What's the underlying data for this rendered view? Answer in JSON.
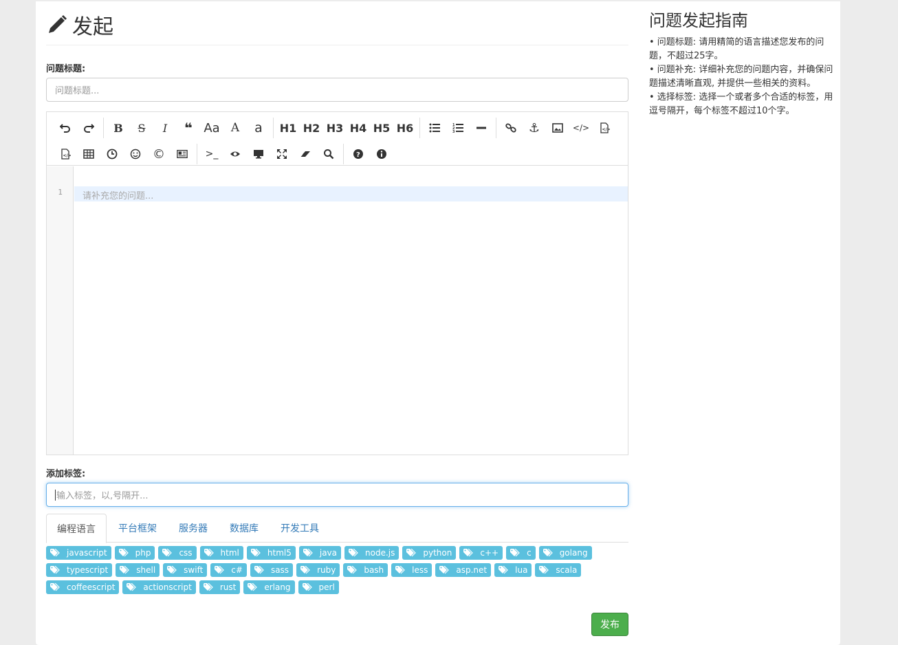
{
  "header": {
    "title": "发起",
    "icon": "pencil-icon"
  },
  "form": {
    "title_label": "问题标题:",
    "title_placeholder": "问题标题...",
    "content_placeholder": "请补充您的问题...",
    "line_number": "1",
    "tags_label": "添加标签:",
    "tags_placeholder": "输入标签，以,号隔开..."
  },
  "toolbar": {
    "row1": [
      "undo-icon",
      "redo-icon",
      "bold-icon",
      "strikethrough-icon",
      "italic-icon",
      "quote-icon",
      "uppercase-icon",
      "case-first-icon",
      "lowercase-icon",
      "h1",
      "h2",
      "h3",
      "h4",
      "h5",
      "h6",
      "unordered-list-icon",
      "ordered-list-icon",
      "horizontal-rule-icon",
      "link-icon",
      "anchor-icon",
      "image-icon",
      "code-icon",
      "code-block-icon"
    ],
    "headings": [
      "H1",
      "H2",
      "H3",
      "H4",
      "H5",
      "H6"
    ],
    "uppercase_text": "Aa",
    "case_first_text": "A",
    "lowercase_text": "a"
  },
  "tabs": [
    "编程语言",
    "平台框架",
    "服务器",
    "数据库",
    "开发工具"
  ],
  "tags": [
    "javascript",
    "php",
    "css",
    "html",
    "html5",
    "java",
    "node.js",
    "python",
    "c++",
    "c",
    "golang",
    "typescript",
    "shell",
    "swift",
    "c#",
    "sass",
    "ruby",
    "bash",
    "less",
    "asp.net",
    "lua",
    "scala",
    "coffeescript",
    "actionscript",
    "rust",
    "erlang",
    "perl"
  ],
  "submit_label": "发布",
  "guide": {
    "title": "问题发起指南",
    "items": [
      "• 问题标题: 请用精简的语言描述您发布的问题，不超过25字。",
      "• 问题补充: 详细补充您的问题内容，并确保问题描述清晰直观, 并提供一些相关的资料。",
      "• 选择标签: 选择一个或者多个合适的标签，用逗号隔开，每个标签不超过10个字。"
    ]
  },
  "colors": {
    "tag_bg": "#5bc0de",
    "submit_bg": "#4cae4c",
    "link": "#337ab7"
  }
}
